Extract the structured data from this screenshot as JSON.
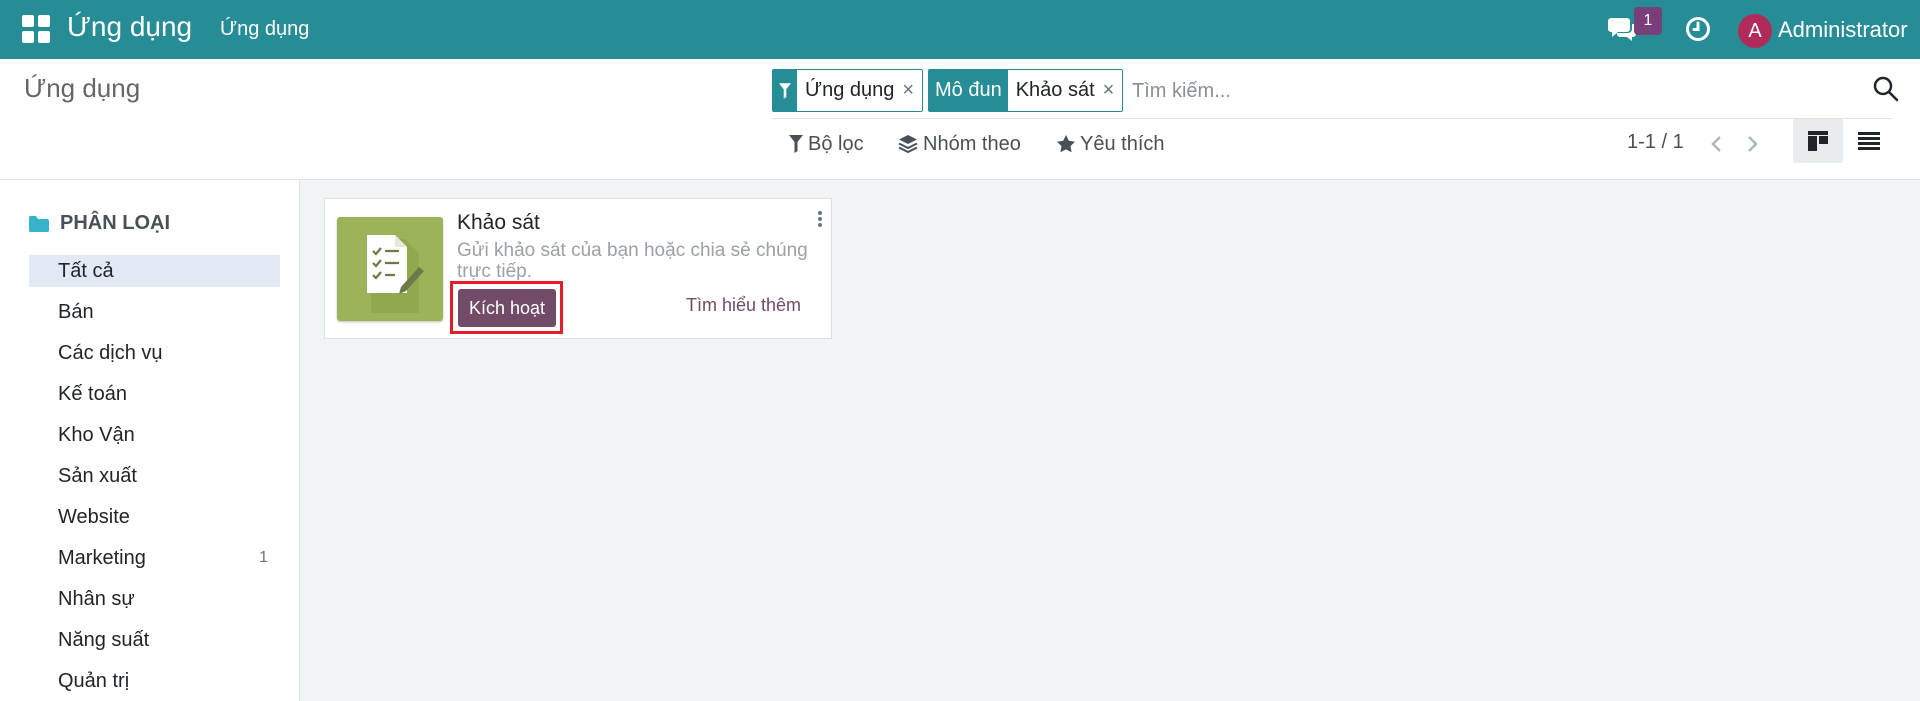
{
  "navbar": {
    "brand": "Ứng dụng",
    "menu": "Ứng dụng",
    "message_count": "1",
    "avatar_letter": "A",
    "user": "Administrator"
  },
  "control_panel": {
    "title": "Ứng dụng",
    "facets": [
      {
        "label_icon": "filter-icon",
        "value": "Ứng dụng"
      },
      {
        "label": "Mô đun",
        "value": "Khảo sát"
      }
    ],
    "facet_close": "×",
    "search_placeholder": "Tìm kiếm...",
    "filters_label": "Bộ lọc",
    "group_by_label": "Nhóm theo",
    "favorites_label": "Yêu thích",
    "pager": "1-1 / 1"
  },
  "sidebar": {
    "header": "PHÂN LOẠI",
    "items": [
      {
        "label": "Tất cả",
        "count": ""
      },
      {
        "label": "Bán",
        "count": ""
      },
      {
        "label": "Các dịch vụ",
        "count": ""
      },
      {
        "label": "Kế toán",
        "count": ""
      },
      {
        "label": "Kho Vận",
        "count": ""
      },
      {
        "label": "Sản xuất",
        "count": ""
      },
      {
        "label": "Website",
        "count": ""
      },
      {
        "label": "Marketing",
        "count": "1"
      },
      {
        "label": "Nhân sự",
        "count": ""
      },
      {
        "label": "Năng suất",
        "count": ""
      },
      {
        "label": "Quản trị",
        "count": ""
      }
    ]
  },
  "card": {
    "title": "Khảo sát",
    "description": "Gửi khảo sát của bạn hoặc chia sẻ chúng trực tiếp.",
    "activate_label": "Kích hoạt",
    "learn_more_label": "Tìm hiểu thêm"
  },
  "colors": {
    "navbar": "#268c96",
    "primary": "#714b67",
    "highlight": "#e31e24"
  }
}
